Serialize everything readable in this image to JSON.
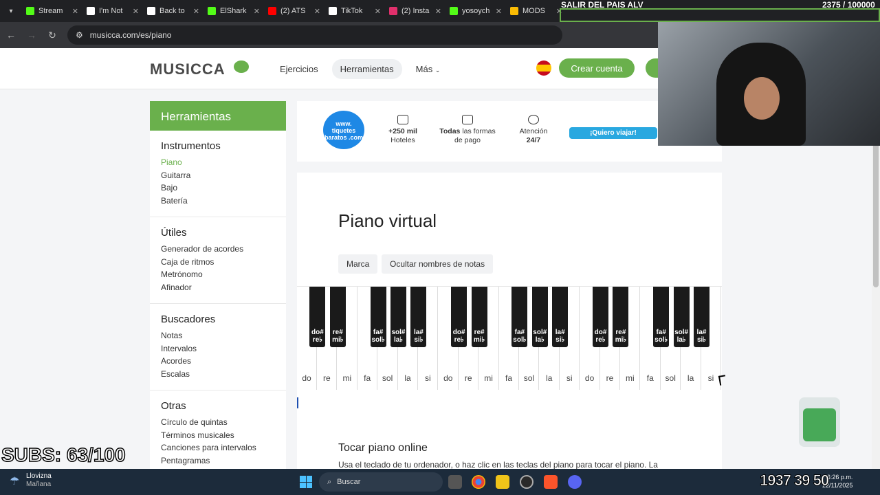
{
  "browser": {
    "tabs": [
      {
        "label": "Stream",
        "color": "#53fc18"
      },
      {
        "label": "I'm Not",
        "color": "#ffffff"
      },
      {
        "label": "Back to",
        "color": "#ffffff"
      },
      {
        "label": "ElShark",
        "color": "#53fc18"
      },
      {
        "label": "(2) ATS",
        "color": "#ff0000"
      },
      {
        "label": "TikTok",
        "color": "#ffffff"
      },
      {
        "label": "(2) Insta",
        "color": "#e1306c"
      },
      {
        "label": "yosoych",
        "color": "#53fc18"
      },
      {
        "label": "MODS",
        "color": "#fbbc04"
      }
    ],
    "url": "musicca.com/es/piano"
  },
  "stream": {
    "title": "SALIR DEL PAIS ALV",
    "count": "2375 / 100000",
    "subs": "SUBS: 63/100"
  },
  "header": {
    "logo": "MUSICCA",
    "nav": [
      "Ejercicios",
      "Herramientas",
      "Más"
    ],
    "create_account": "Crear cuenta"
  },
  "sidebar": {
    "title": "Herramientas",
    "sections": [
      {
        "title": "Instrumentos",
        "items": [
          "Piano",
          "Guitarra",
          "Bajo",
          "Batería"
        ]
      },
      {
        "title": "Útiles",
        "items": [
          "Generador de acordes",
          "Caja de ritmos",
          "Metrónomo",
          "Afinador"
        ]
      },
      {
        "title": "Buscadores",
        "items": [
          "Notas",
          "Intervalos",
          "Acordes",
          "Escalas"
        ]
      },
      {
        "title": "Otras",
        "items": [
          "Círculo de quintas",
          "Términos musicales",
          "Canciones para intervalos",
          "Pentagramas"
        ]
      }
    ]
  },
  "ad": {
    "logo": "www. tiquetes baratos .com",
    "hotels_strong": "+250 mil",
    "hotels": "Hoteles",
    "payment_strong": "Todas",
    "payment": "las formas de pago",
    "support": "Atención",
    "support_strong": "24/7",
    "cta": "¡Quiero viajar!"
  },
  "main": {
    "title": "Piano virtual",
    "btn_brand": "Marca",
    "btn_hide_names": "Ocultar nombres de notas",
    "white_keys": [
      "do",
      "re",
      "mi",
      "fa",
      "sol",
      "la",
      "si",
      "do",
      "re",
      "mi",
      "fa",
      "sol",
      "la",
      "si",
      "do",
      "re",
      "mi",
      "fa",
      "sol",
      "la",
      "si"
    ],
    "black_keys": [
      {
        "top": "do#",
        "bottom": "re♭",
        "after": 0
      },
      {
        "top": "re#",
        "bottom": "mi♭",
        "after": 1
      },
      {
        "top": "fa#",
        "bottom": "sol♭",
        "after": 3
      },
      {
        "top": "sol#",
        "bottom": "la♭",
        "after": 4
      },
      {
        "top": "la#",
        "bottom": "si♭",
        "after": 5
      },
      {
        "top": "do#",
        "bottom": "re♭",
        "after": 7
      },
      {
        "top": "re#",
        "bottom": "mi♭",
        "after": 8
      },
      {
        "top": "fa#",
        "bottom": "sol♭",
        "after": 10
      },
      {
        "top": "sol#",
        "bottom": "la♭",
        "after": 11
      },
      {
        "top": "la#",
        "bottom": "si♭",
        "after": 12
      },
      {
        "top": "do#",
        "bottom": "re♭",
        "after": 14
      },
      {
        "top": "re#",
        "bottom": "mi♭",
        "after": 15
      },
      {
        "top": "fa#",
        "bottom": "sol♭",
        "after": 17
      },
      {
        "top": "sol#",
        "bottom": "la♭",
        "after": 18
      },
      {
        "top": "la#",
        "bottom": "si♭",
        "after": 19
      }
    ],
    "subtitle": "Tocar piano online",
    "text": "Usa el teclado de tu ordenador, o haz clic en las teclas del piano para tocar el piano. La"
  },
  "taskbar": {
    "weather": "Llovizna",
    "weather_sub": "Mañana",
    "search": "Buscar",
    "time": "6:26 p.m.",
    "date": "22/11/2025",
    "overlay_numbers": "1937 39 50"
  }
}
